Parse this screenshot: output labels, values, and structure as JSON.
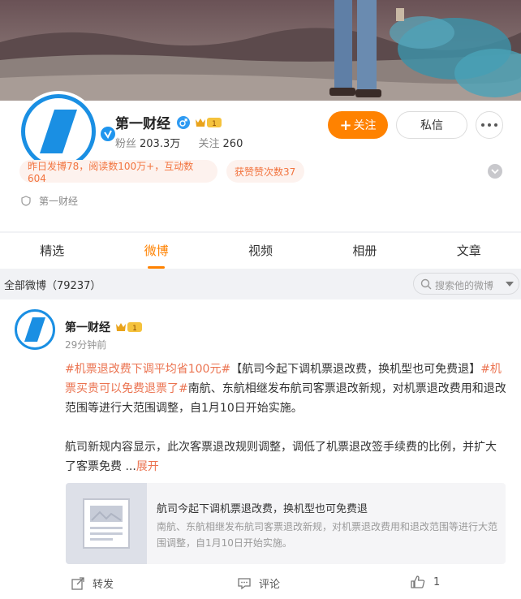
{
  "profile": {
    "name": "第一财经",
    "fans_label": "粉丝",
    "fans_value": "203.3万",
    "following_label": "关注",
    "following_value": "260",
    "follow_button": "关注",
    "follow_plus": "+",
    "message_button": "私信",
    "vip_label": "1",
    "tags": [
      "昨日发博78，阅读数100万+，互动数604",
      "获赞赞次数37"
    ],
    "org": "第一财经"
  },
  "tabs": [
    "精选",
    "微博",
    "视频",
    "相册",
    "文章"
  ],
  "active_tab": "微博",
  "filter": {
    "all_posts": "全部微博（79237）",
    "search_placeholder": "搜索他的微博"
  },
  "post": {
    "author": "第一财经",
    "vip_label": "1",
    "time": "29分钟前",
    "hashtag1": "#机票退改费下调平均省100元#",
    "text1": "【航司今起下调机票退改费，换机型也可免费退】",
    "hashtag2": "#机票买贵可以免费退票了#",
    "text2": "南航、东航相继发布航司客票退改新规，对机票退改费用和退改范围等进行大范围调整，自1月10日开始实施。",
    "text3": "航司新规内容显示，此次客票退改规则调整，调低了机票退改签手续费的比例，并扩大了客票免费 ...",
    "expand": "展开",
    "card_title": "航司今起下调机票退改费，换机型也可免费退",
    "card_desc": "南航、东航相继发布航司客票退改新规，对机票退改费用和退改范围等进行大范围调整，自1月10日开始实施。",
    "forward": "转发",
    "comment": "评论",
    "like_count": "1"
  },
  "colors": {
    "accent": "#ff8200",
    "hashtag": "#eb7350",
    "brand_blue": "#1a8fe3"
  },
  "icons": {
    "gender": "male-icon",
    "verified": "verified-icon",
    "more": "more-dots-icon",
    "expand": "chevron-down-icon",
    "org": "shield-icon",
    "search": "search-icon",
    "forward": "share-icon",
    "comment": "comment-icon",
    "like": "thumbs-up-icon"
  }
}
